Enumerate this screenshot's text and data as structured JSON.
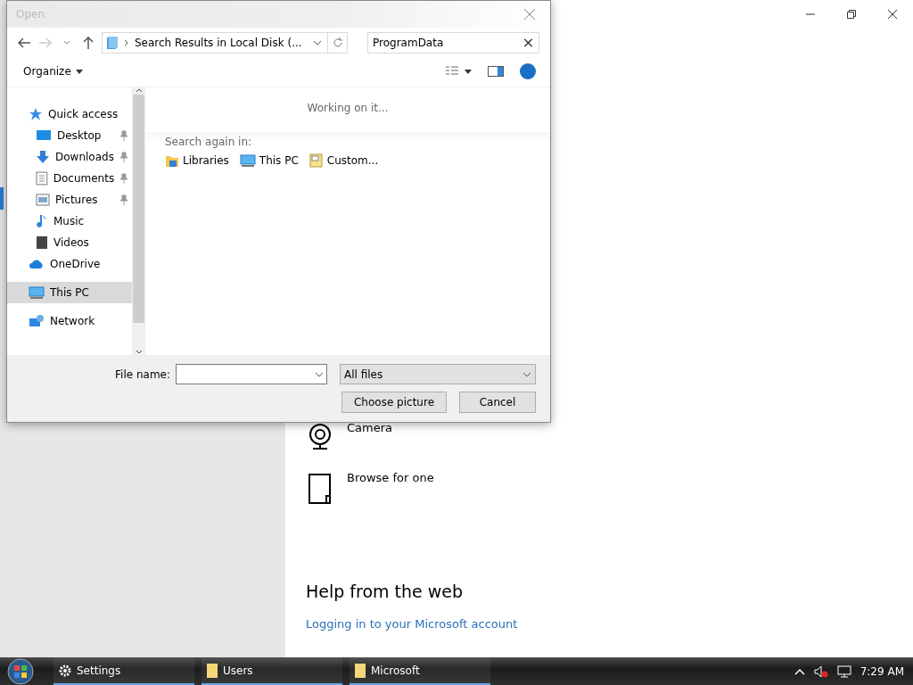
{
  "settings_window": {
    "options": [
      {
        "kind": "camera",
        "label": "Camera"
      },
      {
        "kind": "browse",
        "label": "Browse for one"
      }
    ],
    "help_heading": "Help from the web",
    "help_link": "Logging in to your Microsoft account"
  },
  "dialog": {
    "title": "Open",
    "address": "Search Results in Local Disk (...",
    "search_value": "ProgramData",
    "organize": "Organize",
    "status": "Working on it...",
    "search_again_label": "Search again in:",
    "search_again": [
      {
        "kind": "libraries",
        "label": "Libraries"
      },
      {
        "kind": "pc",
        "label": "This PC"
      },
      {
        "kind": "custom",
        "label": "Custom..."
      }
    ],
    "nav": [
      {
        "kind": "quick",
        "label": "Quick access",
        "pinned": false,
        "selected": false,
        "children": [
          {
            "kind": "desktop",
            "label": "Desktop",
            "pinned": true,
            "selected": false
          },
          {
            "kind": "downloads",
            "label": "Downloads",
            "pinned": true,
            "selected": false
          },
          {
            "kind": "documents",
            "label": "Documents",
            "pinned": true,
            "selected": false
          },
          {
            "kind": "pictures",
            "label": "Pictures",
            "pinned": true,
            "selected": false
          },
          {
            "kind": "music",
            "label": "Music",
            "pinned": false,
            "selected": false
          },
          {
            "kind": "videos",
            "label": "Videos",
            "pinned": false,
            "selected": false
          }
        ]
      },
      {
        "kind": "onedrive",
        "label": "OneDrive",
        "pinned": false,
        "selected": false
      },
      {
        "kind": "pc",
        "label": "This PC",
        "pinned": false,
        "selected": true
      },
      {
        "kind": "network",
        "label": "Network",
        "pinned": false,
        "selected": false
      }
    ],
    "file_name_label": "File name:",
    "file_type": "All files",
    "buttons": [
      "Choose picture",
      "Cancel"
    ]
  },
  "taskbar": {
    "items": [
      {
        "kind": "gear",
        "label": "Settings"
      },
      {
        "kind": "folder",
        "label": "Users"
      },
      {
        "kind": "folder",
        "label": "Microsoft"
      }
    ],
    "clock": "7:29 AM"
  }
}
